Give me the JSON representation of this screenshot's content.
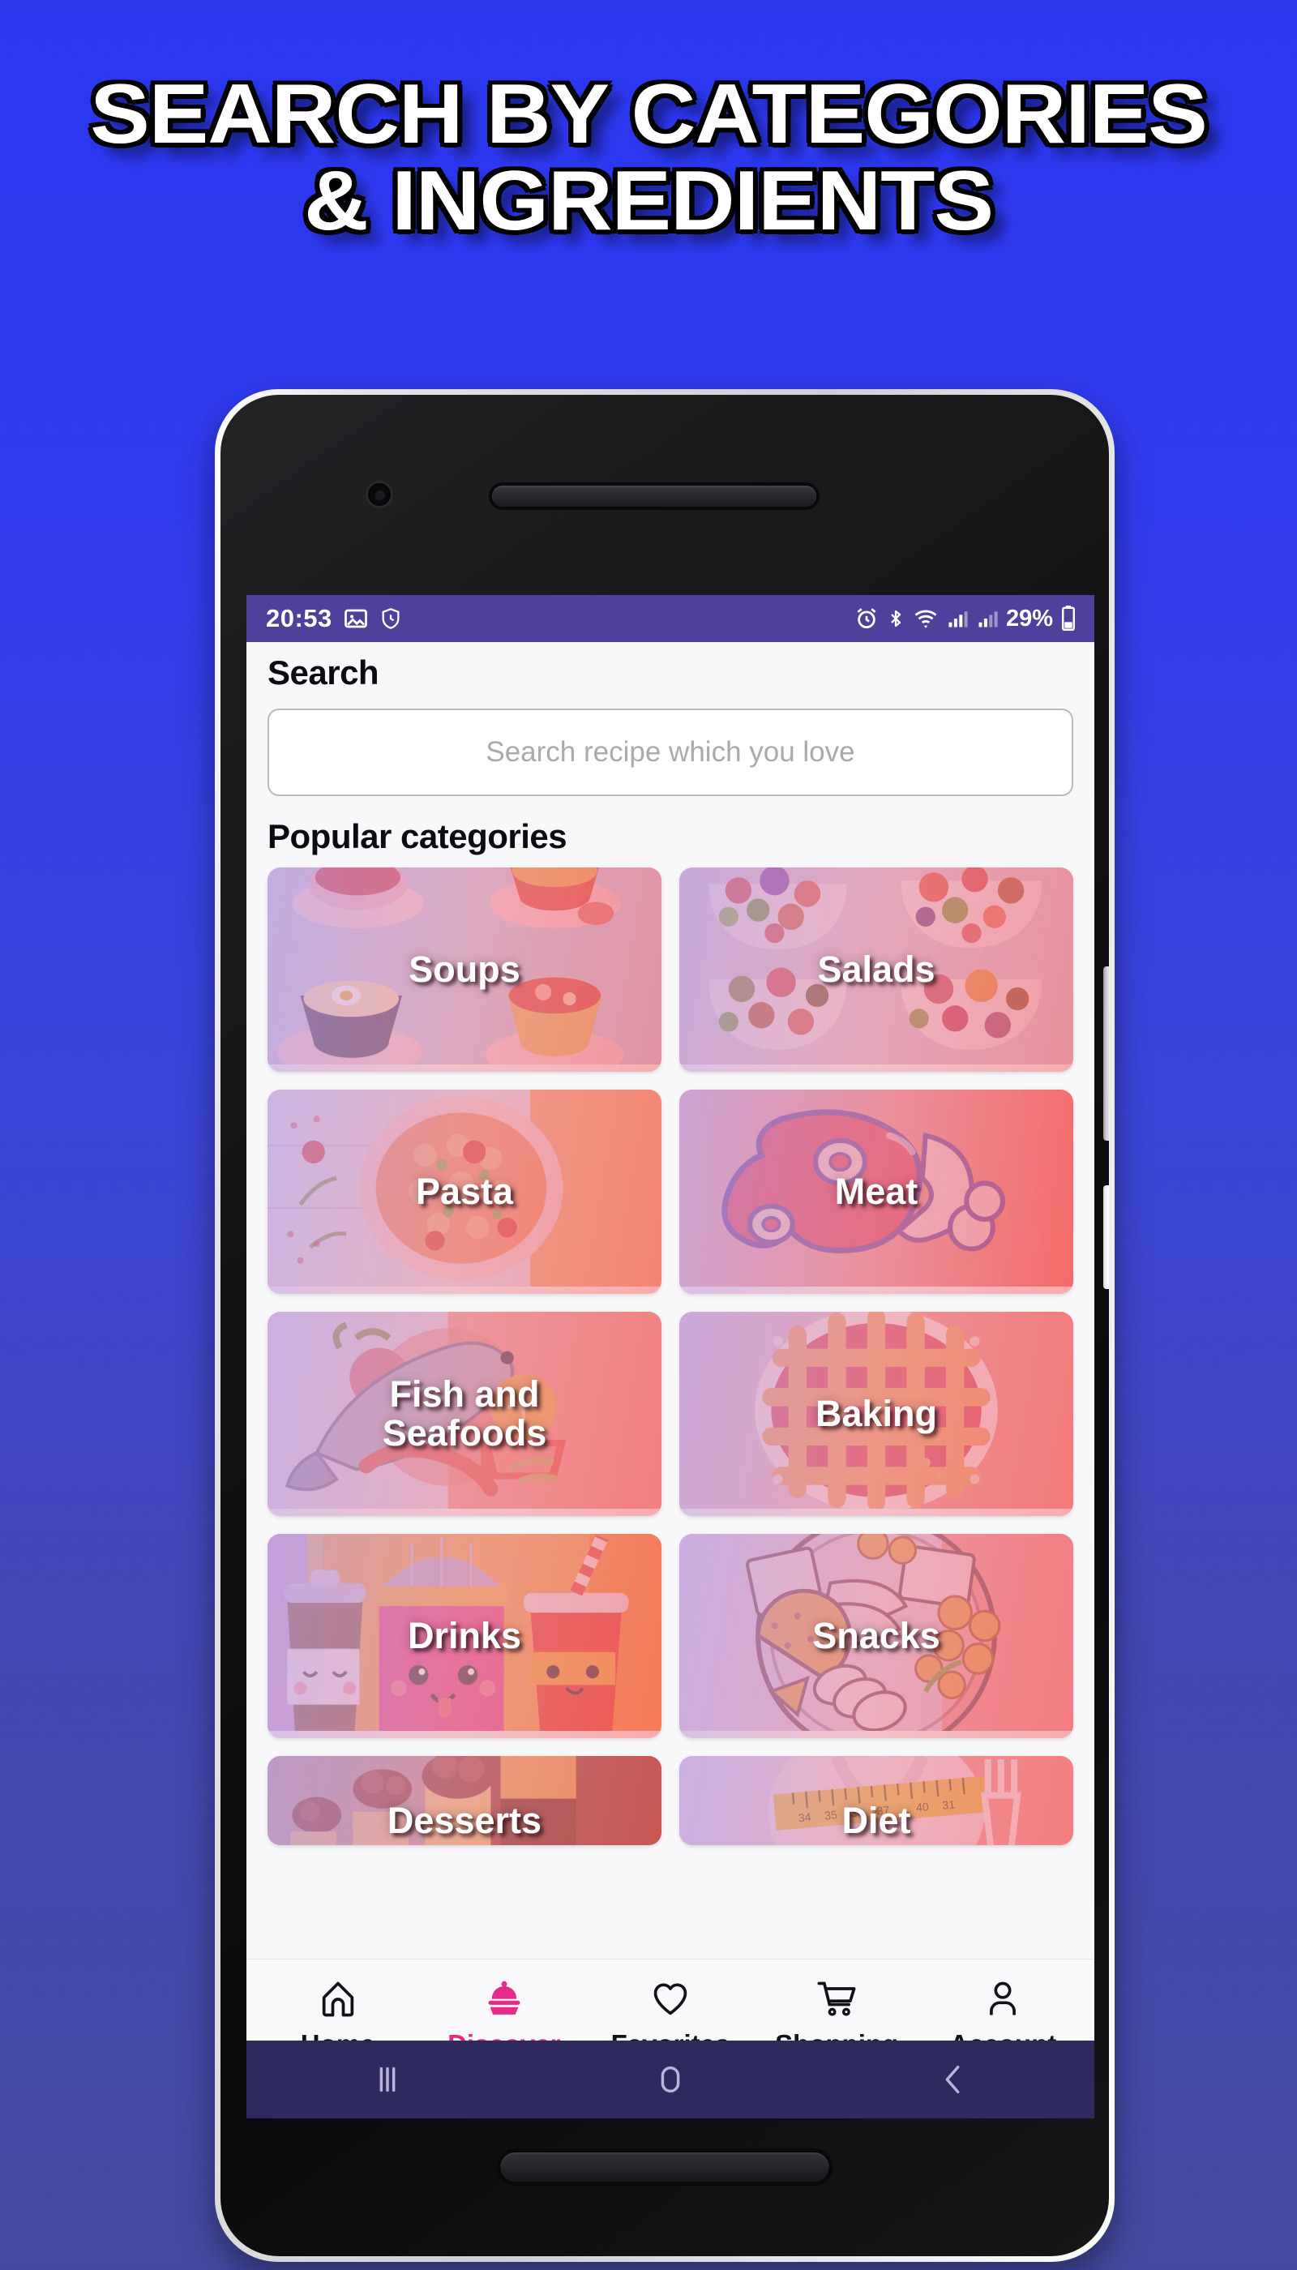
{
  "promo": {
    "line1": "SEARCH BY CATEGORIES",
    "line2": "& INGREDIENTS"
  },
  "status_bar": {
    "time": "20:53",
    "battery": "29%",
    "icons": [
      "image-icon",
      "shield-icon",
      "alarm-icon",
      "bluetooth-icon",
      "wifi-icon",
      "signal-icon",
      "signal-icon-2",
      "battery-icon"
    ]
  },
  "app": {
    "title": "Search",
    "search": {
      "placeholder": "Search recipe which you love",
      "value": ""
    },
    "section_title": "Popular categories",
    "categories": [
      {
        "label": "Soups"
      },
      {
        "label": "Salads"
      },
      {
        "label": "Pasta"
      },
      {
        "label": "Meat"
      },
      {
        "label": "Fish and\nSeafoods"
      },
      {
        "label": "Baking"
      },
      {
        "label": "Drinks"
      },
      {
        "label": "Snacks"
      },
      {
        "label": "Desserts"
      },
      {
        "label": "Diet"
      }
    ]
  },
  "bottom_nav": {
    "active": "Discover",
    "active_color": "#e62a8b",
    "items": [
      {
        "label": "Home",
        "icon": "home-icon"
      },
      {
        "label": "Discover",
        "icon": "cloche-icon"
      },
      {
        "label": "Favorites",
        "icon": "heart-icon"
      },
      {
        "label": "Shopping",
        "icon": "cart-icon"
      },
      {
        "label": "Account",
        "icon": "person-icon"
      }
    ]
  },
  "android_nav": {
    "recents": "recents-icon",
    "home": "home-pill-icon",
    "back": "back-icon"
  },
  "theme": {
    "background_top": "#2b37ef",
    "background_bottom": "#444aa0",
    "status_bar": "#4e419c",
    "android_nav": "#2e2a5e",
    "accent": "#e62a8b"
  }
}
